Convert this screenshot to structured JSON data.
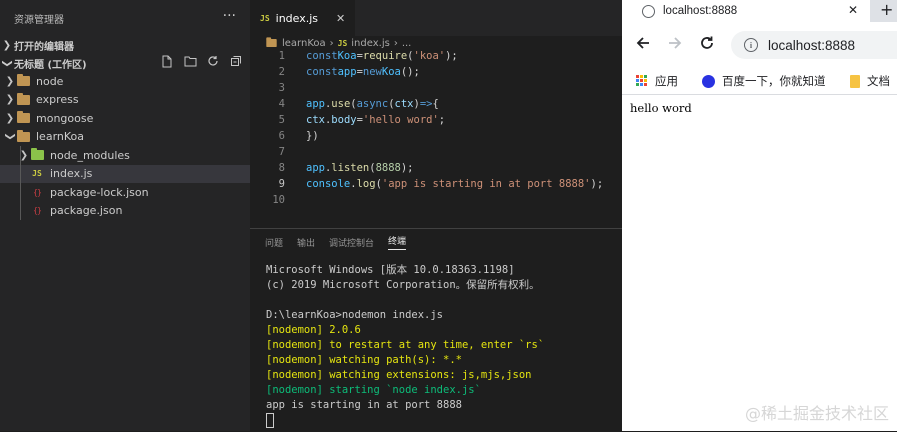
{
  "sidebar": {
    "title": "资源管理器",
    "more": "···",
    "open_editors": "打开的编辑器",
    "workspace": "无标题 (工作区)",
    "tree": [
      {
        "label": "node",
        "kind": "folder"
      },
      {
        "label": "express",
        "kind": "folder"
      },
      {
        "label": "mongoose",
        "kind": "folder"
      },
      {
        "label": "learnKoa",
        "kind": "folder"
      },
      {
        "label": "node_modules",
        "kind": "folder-green"
      },
      {
        "label": "index.js",
        "kind": "js"
      },
      {
        "label": "package-lock.json",
        "kind": "json"
      },
      {
        "label": "package.json",
        "kind": "json"
      }
    ]
  },
  "editor": {
    "tab_label": "index.js",
    "tab_icon": "JS",
    "tab_close": "✕",
    "breadcrumb": [
      "learnKoa",
      "index.js",
      "..."
    ],
    "line_numbers": [
      "1",
      "2",
      "3",
      "4",
      "5",
      "6",
      "7",
      "8",
      "9",
      "10"
    ],
    "code": {
      "l1": [
        "const",
        "Koa",
        "=",
        "require",
        "(",
        "'koa'",
        ");"
      ],
      "l2": [
        "const",
        "app",
        "=",
        "new",
        "Koa",
        "();"
      ],
      "l4": [
        "app",
        ".",
        "use",
        "(",
        "async",
        "(",
        "ctx",
        ")",
        "=>",
        "{"
      ],
      "l5": [
        "ctx",
        ".",
        "body",
        "=",
        "'hello word'",
        ";"
      ],
      "l6": "})",
      "l8": [
        "app",
        ".",
        "listen",
        "(",
        "8888",
        ");"
      ],
      "l9": [
        "console",
        ".",
        "log",
        "(",
        "'app is starting in at port 8888'",
        ");"
      ]
    }
  },
  "panel": {
    "tabs": [
      "问题",
      "输出",
      "调试控制台",
      "终端"
    ],
    "terminal": [
      "Microsoft Windows [版本 10.0.18363.1198]",
      "(c) 2019 Microsoft Corporation。保留所有权利。",
      "",
      "D:\\learnKoa>nodemon index.js",
      "[nodemon] 2.0.6",
      "[nodemon] to restart at any time, enter `rs`",
      "[nodemon] watching path(s): *.*",
      "[nodemon] watching extensions: js,mjs,json",
      "[nodemon] starting `node index.js`",
      "app is starting in at port 8888"
    ]
  },
  "browser": {
    "tab_title": "localhost:8888",
    "close": "✕",
    "new_tab": "+",
    "url": "localhost:8888",
    "info": "i",
    "bookmarks": [
      "应用",
      "百度一下，你就知道",
      "文档"
    ],
    "page_text": "hello word"
  },
  "watermark": "@稀土掘金技术社区",
  "colors": {
    "sidebar_bg": "#252526",
    "editor_bg": "#1e1e1e",
    "nodemon_yellow": "#e5e510",
    "nodemon_green": "#0dbc79"
  }
}
